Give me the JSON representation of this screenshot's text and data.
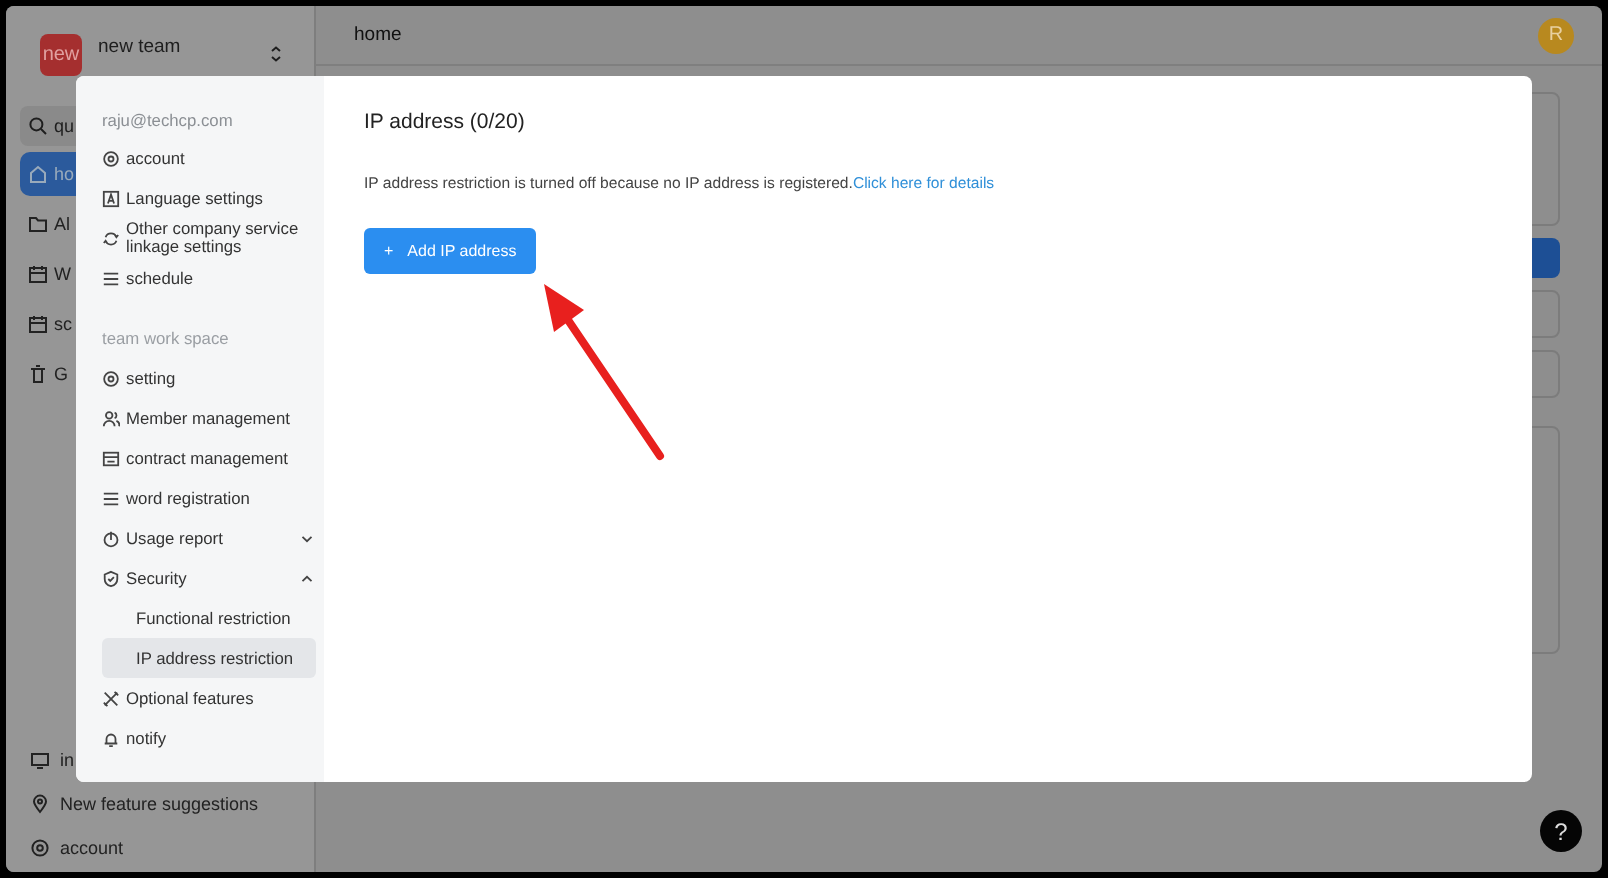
{
  "app": {
    "team": {
      "logo": "new",
      "name": "new team"
    },
    "search": {
      "value": "qu"
    },
    "nav": [
      {
        "label": "ho",
        "selected": true
      },
      {
        "label": "Al",
        "selected": false
      },
      {
        "label": "W",
        "selected": false
      },
      {
        "label": "sc",
        "selected": false
      },
      {
        "label": "G",
        "selected": false
      }
    ],
    "footer": [
      {
        "label": "in"
      },
      {
        "label": "New feature suggestions"
      },
      {
        "label": "account"
      }
    ],
    "header": {
      "title": "home",
      "avatar": "R"
    },
    "help": "?"
  },
  "modal": {
    "sidebar": {
      "email": "raju@techcp.com",
      "items": [
        {
          "label": "account",
          "selected": false
        },
        {
          "label": "Language settings",
          "selected": false
        },
        {
          "label": "Other company service linkage settings",
          "selected": false
        },
        {
          "label": "schedule",
          "selected": false
        }
      ],
      "section_title": "team work space",
      "section_items": [
        {
          "label": "setting",
          "selected": false
        },
        {
          "label": "Member management",
          "selected": false
        },
        {
          "label": "contract management",
          "selected": false
        },
        {
          "label": "word registration",
          "selected": false
        },
        {
          "label": "Usage report",
          "selected": false,
          "expanded": false
        },
        {
          "label": "Security",
          "selected": false,
          "expanded": true,
          "children": [
            {
              "label": "Functional restriction",
              "selected": false
            },
            {
              "label": "IP address restriction",
              "selected": true
            }
          ]
        },
        {
          "label": "Optional features",
          "selected": false
        },
        {
          "label": "notify",
          "selected": false
        }
      ]
    },
    "content": {
      "title": "IP address (0/20)",
      "notice": "IP address restriction is turned off because no IP address is registered.",
      "link": "Click here for details",
      "button": {
        "icon": "+",
        "label": "Add IP address"
      }
    }
  }
}
